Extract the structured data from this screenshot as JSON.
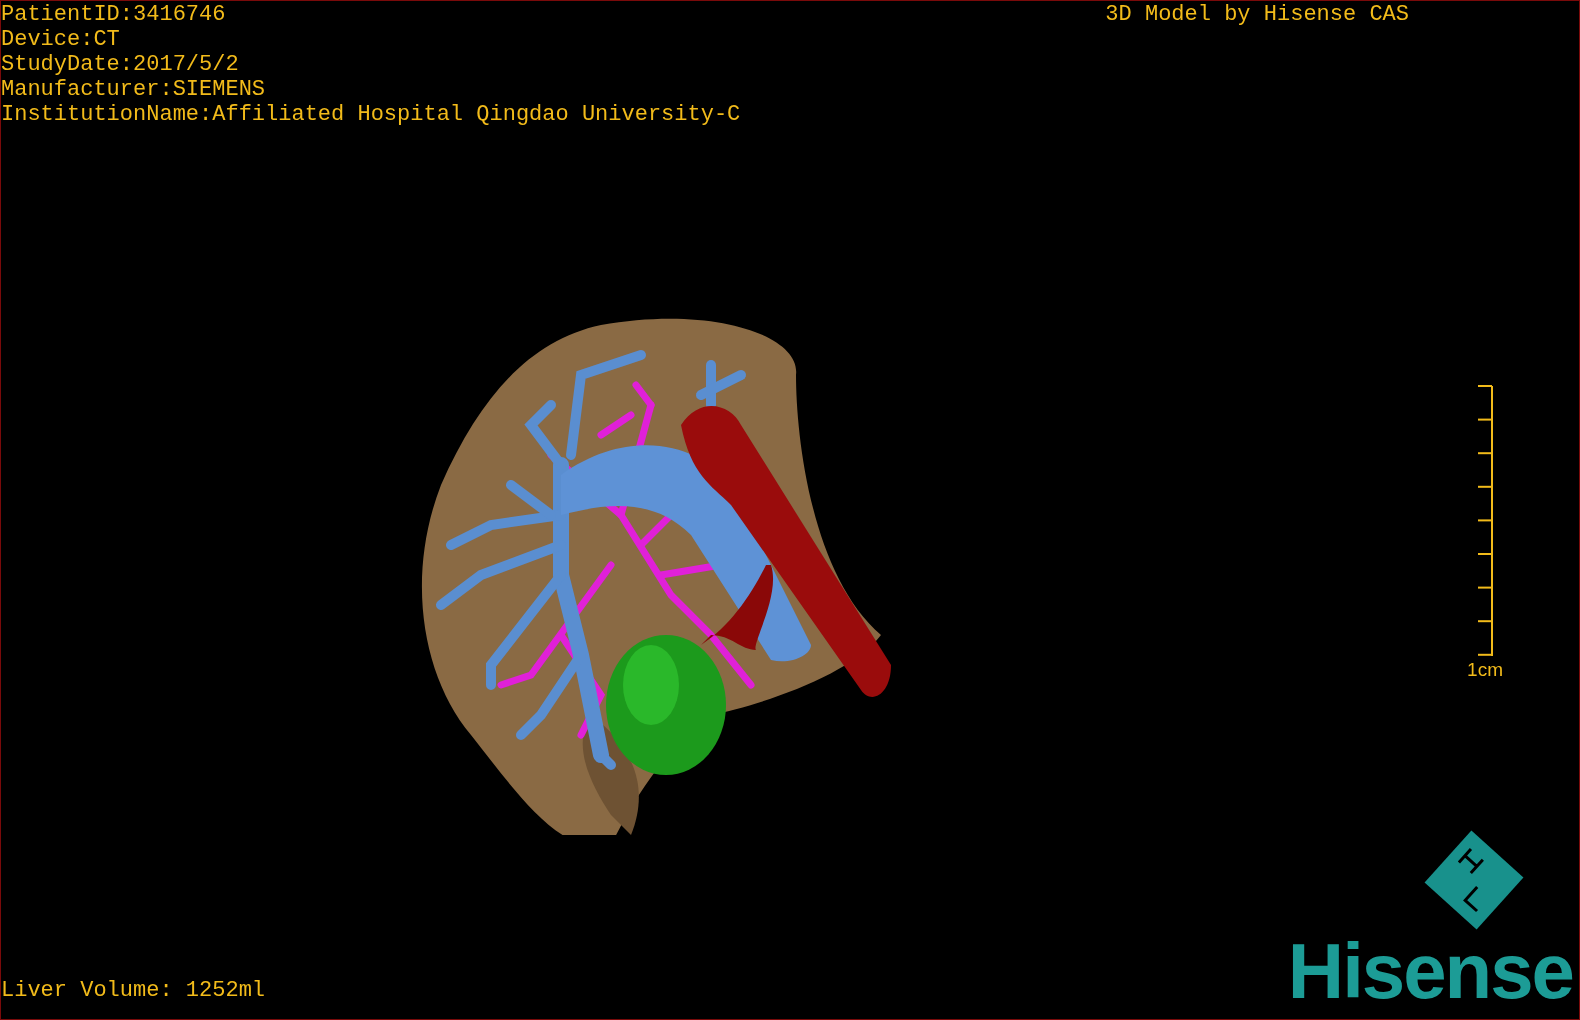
{
  "patient_info": [
    "PatientID:3416746",
    "Device:CT",
    "StudyDate:2017/5/2",
    "Manufacturer:SIEMENS",
    "InstitutionName:Affiliated Hospital Qingdao University-C"
  ],
  "title": "3D Model by Hisense CAS",
  "scale_bar": {
    "label": "1cm"
  },
  "liver_volume": "Liver Volume: 1252ml",
  "logo": {
    "text": "Hisense"
  }
}
